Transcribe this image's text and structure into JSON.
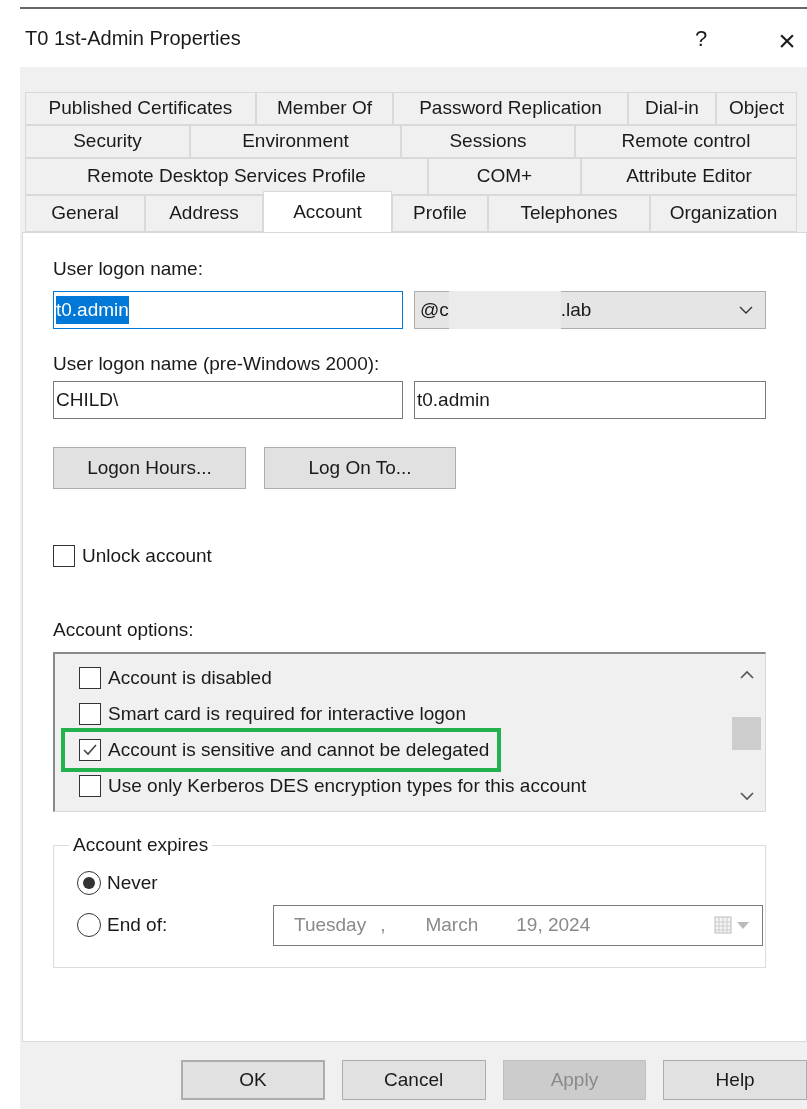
{
  "window": {
    "title": "T0 1st-Admin Properties",
    "help": "?",
    "close": "×"
  },
  "tab_rows": [
    [
      {
        "label": "Published Certificates",
        "selected": false
      },
      {
        "label": "Member Of",
        "selected": false
      },
      {
        "label": "Password Replication",
        "selected": false
      },
      {
        "label": "Dial-in",
        "selected": false
      },
      {
        "label": "Object",
        "selected": false
      }
    ],
    [
      {
        "label": "Security",
        "selected": false
      },
      {
        "label": "Environment",
        "selected": false
      },
      {
        "label": "Sessions",
        "selected": false
      },
      {
        "label": "Remote control",
        "selected": false
      }
    ],
    [
      {
        "label": "Remote Desktop Services Profile",
        "selected": false
      },
      {
        "label": "COM+",
        "selected": false
      },
      {
        "label": "Attribute Editor",
        "selected": false
      }
    ],
    [
      {
        "label": "General",
        "selected": false
      },
      {
        "label": "Address",
        "selected": false
      },
      {
        "label": "Account",
        "selected": true
      },
      {
        "label": "Profile",
        "selected": false
      },
      {
        "label": "Telephones",
        "selected": false
      },
      {
        "label": "Organization",
        "selected": false
      }
    ]
  ],
  "logon_name": {
    "label": "User logon name:",
    "value": "t0.admin",
    "text_selected": true,
    "domain_prefix": "@c",
    "domain_suffix": ".lab",
    "domain_redacted": true
  },
  "pre2000": {
    "label": "User logon name (pre-Windows 2000):",
    "domain": "CHILD\\",
    "value": "t0.admin"
  },
  "buttons_mid": [
    "Logon Hours...",
    "Log On To..."
  ],
  "unlock": {
    "label": "Unlock account",
    "checked": false
  },
  "account_options": {
    "label": "Account options:",
    "items": [
      {
        "label": "Account is disabled",
        "checked": false,
        "highlighted": false
      },
      {
        "label": "Smart card is required for interactive logon",
        "checked": false,
        "highlighted": false
      },
      {
        "label": "Account is sensitive and cannot be delegated",
        "checked": true,
        "highlighted": true
      },
      {
        "label": "Use only Kerberos DES encryption types for this account",
        "checked": false,
        "highlighted": false
      }
    ]
  },
  "account_expires": {
    "label": "Account expires",
    "options": [
      {
        "label": "Never",
        "selected": true
      },
      {
        "label": "End of:",
        "selected": false
      }
    ],
    "date": {
      "weekday": "Tuesday",
      "separator": ",",
      "month": "March",
      "day_year": "19, 2024",
      "disabled": true
    }
  },
  "buttons": [
    {
      "label": "OK",
      "default": true,
      "disabled": false
    },
    {
      "label": "Cancel",
      "default": false,
      "disabled": false
    },
    {
      "label": "Apply",
      "default": false,
      "disabled": true
    },
    {
      "label": "Help",
      "default": false,
      "disabled": false
    }
  ]
}
